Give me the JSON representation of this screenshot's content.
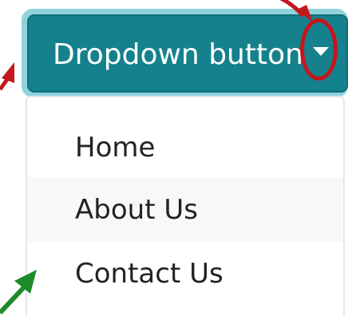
{
  "dropdown": {
    "button_label": "Dropdown button",
    "caret_icon": "caret-down-icon",
    "items": [
      {
        "label": "Home"
      },
      {
        "label": "About Us"
      },
      {
        "label": "Contact Us"
      }
    ]
  },
  "annotations": {
    "highlight_color": "#c4161c",
    "green_arrow_color": "#1f8a2a",
    "red_arrow_color": "#c4161c"
  },
  "colors": {
    "button_bg": "#15818d",
    "button_border": "#0f6f7a",
    "focus_ring": "#8fd3dc",
    "menu_border": "#e3e8ea",
    "hover_bg": "#f7f8f9"
  }
}
